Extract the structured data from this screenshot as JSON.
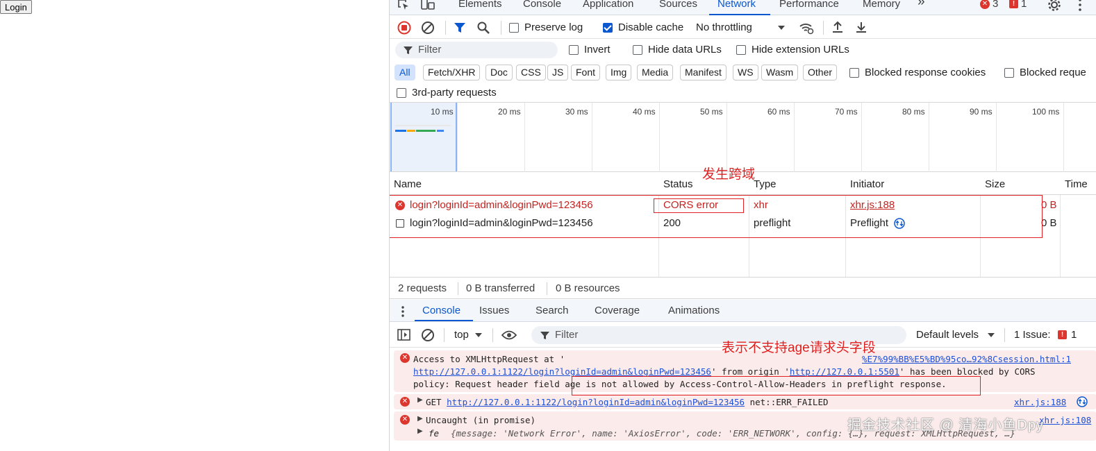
{
  "page": {
    "login_button": "Login"
  },
  "devtools": {
    "tabs": [
      "Elements",
      "Console",
      "Application",
      "Sources",
      "Network",
      "Performance",
      "Memory"
    ],
    "active_tab": "Network",
    "more_tabs": "»",
    "error_count": "3",
    "issue_count": "1"
  },
  "toolbar": {
    "preserve_log": "Preserve log",
    "disable_cache": "Disable cache",
    "throttling": "No throttling"
  },
  "filter": {
    "placeholder": "Filter",
    "invert": "Invert",
    "hide_data_urls": "Hide data URLs",
    "hide_extension_urls": "Hide extension URLs",
    "types": [
      "All",
      "Fetch/XHR",
      "Doc",
      "CSS",
      "JS",
      "Font",
      "Img",
      "Media",
      "Manifest",
      "WS",
      "Wasm",
      "Other"
    ],
    "blocked_cookies": "Blocked response cookies",
    "blocked_requests": "Blocked reque",
    "third_party": "3rd-party requests"
  },
  "overview": {
    "ticks": [
      "10 ms",
      "20 ms",
      "30 ms",
      "40 ms",
      "50 ms",
      "60 ms",
      "70 ms",
      "80 ms",
      "90 ms",
      "100 ms"
    ]
  },
  "table": {
    "headers": {
      "name": "Name",
      "status": "Status",
      "type": "Type",
      "initiator": "Initiator",
      "size": "Size",
      "time": "Time"
    },
    "rows": [
      {
        "name": "login?loginId=admin&loginPwd=123456",
        "status": "CORS error",
        "type": "xhr",
        "initiator": "xhr.js:188",
        "size": "0 B"
      },
      {
        "name": "login?loginId=admin&loginPwd=123456",
        "status": "200",
        "type": "preflight",
        "initiator": "Preflight",
        "size": "0 B"
      }
    ]
  },
  "summary": {
    "requests": "2 requests",
    "transferred": "0 B transferred",
    "resources": "0 B resources"
  },
  "drawer": {
    "tabs": [
      "Console",
      "Issues",
      "Search",
      "Coverage",
      "Animations"
    ],
    "context": "top",
    "filter_placeholder": "Filter",
    "levels": "Default levels",
    "issues_label": "1 Issue:",
    "issues_count": "1"
  },
  "console": {
    "msg1": {
      "line1": "Access to XMLHttpRequest at '",
      "source": "%E7%99%BB%E5%BD%95co…92%8Csession.html:1",
      "url": "http://127.0.0.1:1122/login?loginId=admin&loginPwd=123456",
      "from_origin": "' from origin '",
      "origin": "http://127.0.0.1:5501",
      "tail": "' has been blocked by CORS",
      "line3a": "policy: Request header field ",
      "line3b": "age is not allowed by Access-Control-Allow-Headers in preflight response."
    },
    "msg2": {
      "method": "GET",
      "url": "http://127.0.0.1:1122/login?loginId=admin&loginPwd=123456",
      "error": "net::ERR_FAILED",
      "source": "xhr.js:188"
    },
    "msg3": {
      "line1": "Uncaught (in promise)",
      "source": "xhr.js:108",
      "line2_prefix": "fe",
      "line2": "{message: 'Network Error', name: 'AxiosError', code: 'ERR_NETWORK', config: {…}, request: XMLHttpRequest, …}"
    }
  },
  "annotations": {
    "cors": "发生跨域",
    "header": "表示不支持age请求头字段"
  },
  "watermark": "掘金技术社区 @ 清海小鱼Dpy"
}
